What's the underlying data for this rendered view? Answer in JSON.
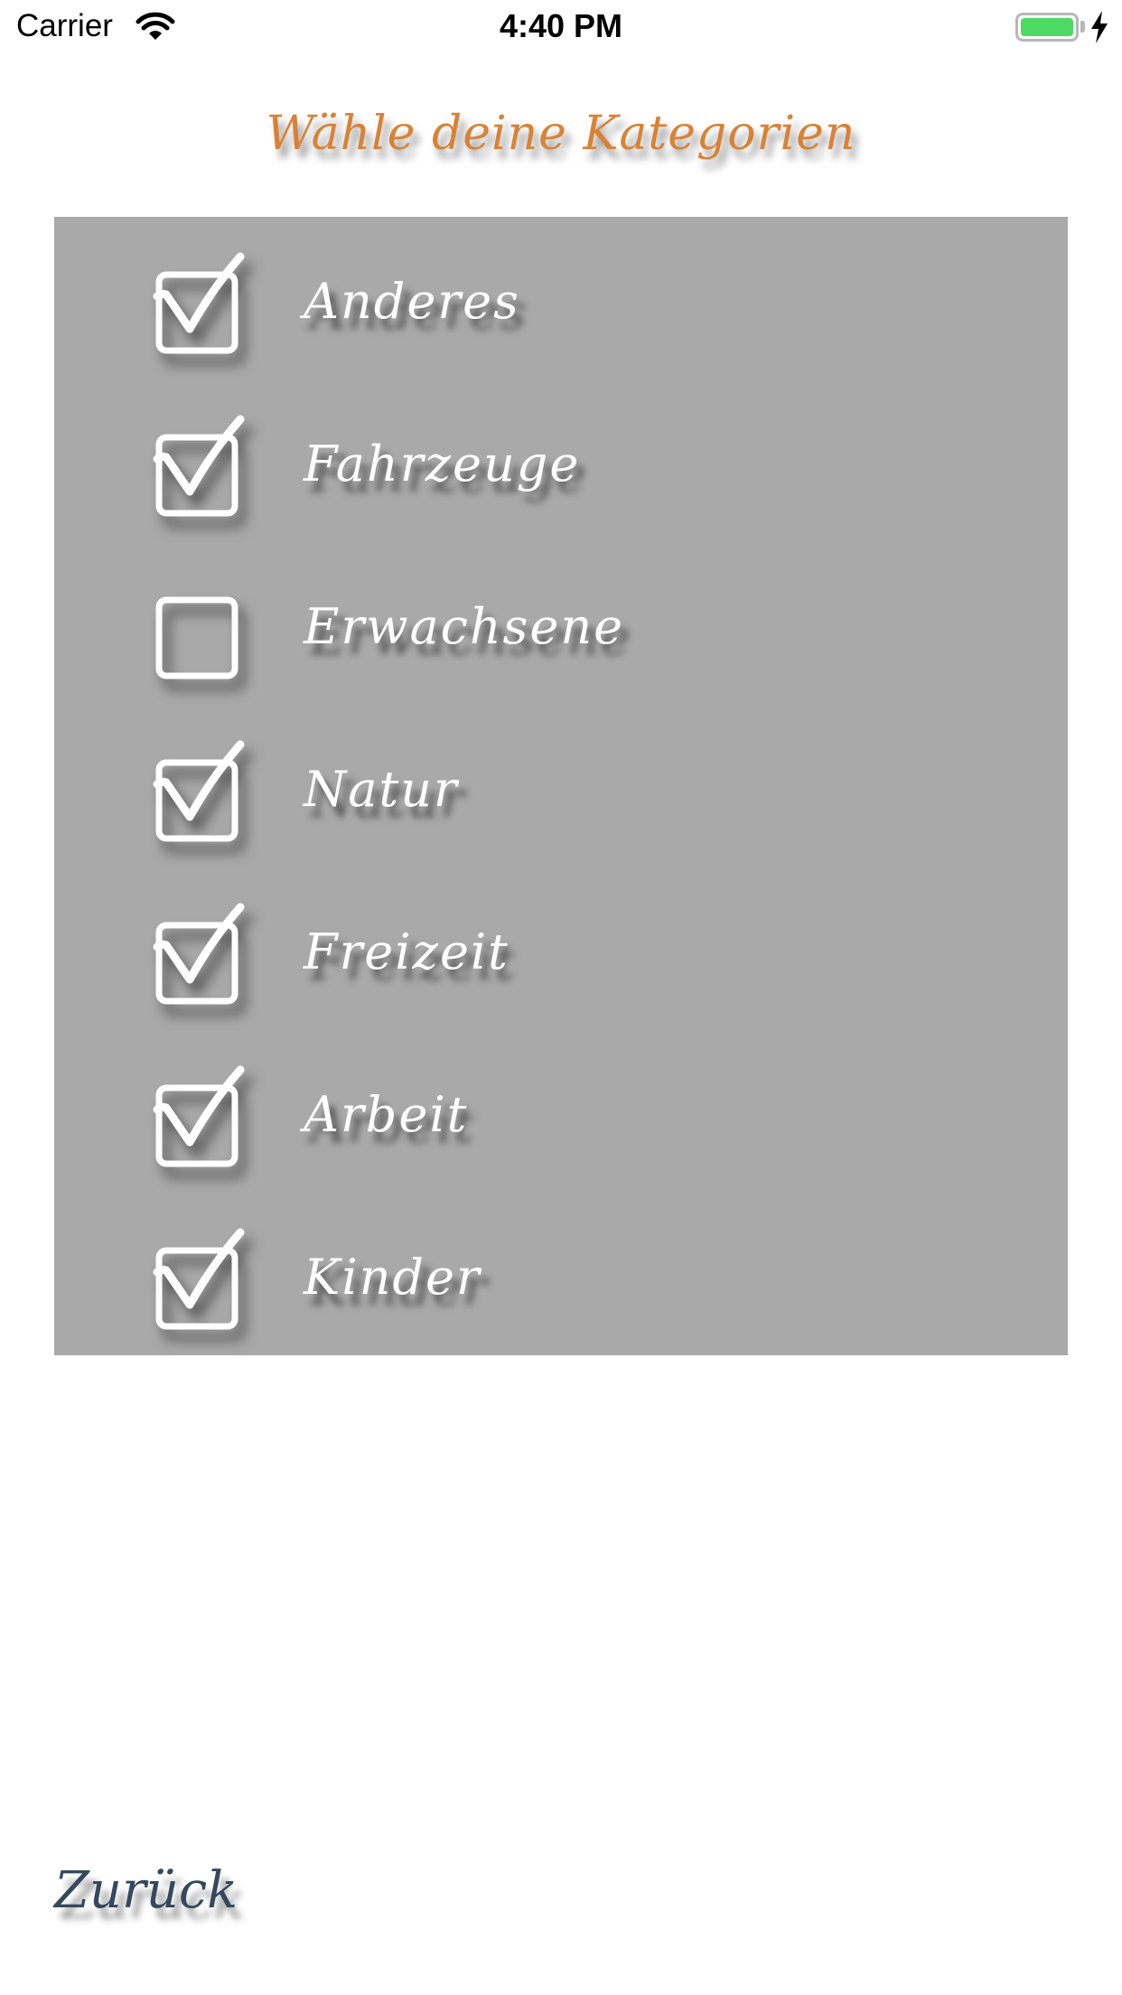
{
  "status_bar": {
    "carrier": "Carrier",
    "time": "4:40 PM",
    "battery_color": "#4cd964"
  },
  "title": "Wähle deine Kategorien",
  "colors": {
    "title": "#d98236",
    "panel": "#a9a9a9",
    "label": "#ffffff",
    "back": "#34495e"
  },
  "categories": [
    {
      "label": "Anderes",
      "checked": true
    },
    {
      "label": "Fahrzeuge",
      "checked": true
    },
    {
      "label": "Erwachsene",
      "checked": false
    },
    {
      "label": "Natur",
      "checked": true
    },
    {
      "label": "Freizeit",
      "checked": true
    },
    {
      "label": "Arbeit",
      "checked": true
    },
    {
      "label": "Kinder",
      "checked": true
    }
  ],
  "back_label": "Zurück"
}
